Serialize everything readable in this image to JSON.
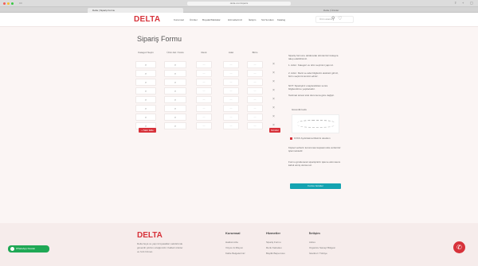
{
  "browser": {
    "url": "delta.com/siparis",
    "tabs": [
      "Delta | Sipariş Formu",
      "Delta | Ürünler"
    ]
  },
  "nav": {
    "logo": "DELTA",
    "menu": [
      "Kurumsal",
      "Ürünler",
      "Boyalar/Markalar",
      "Hizmetlerimiz",
      "İletişim",
      "Sık Sorulan",
      "Katalog"
    ],
    "search_placeholder": "Ürün arama"
  },
  "page_title": "Sipariş Formu",
  "table": {
    "headers": [
      "Kategori Seçin",
      "Ürün Adı / Kodu",
      "Renk",
      "Adet",
      "Birim"
    ],
    "rows": 8,
    "row_placeholder": "—"
  },
  "buttons": {
    "add_row": "+ Satır Ekle",
    "submit_small": "Gönder",
    "submit": "Formu Gönder"
  },
  "info": {
    "p1": "Sipariş formunu doldurarak ürünlerinizi kolayca talep edebilirsiniz.",
    "p2": "1. Adım: Kategori ve ürün seçimini yapınız.",
    "p3": "2. Adım: Renk ve adet bilgilerini eksiksiz giriniz, birim seçimini kontrol ediniz.",
    "p4": "NOT: Siparişiniz onaylandıktan sonra bilgilendirme yapılacaktır.",
    "p5": "Teslimat süresi stok durumuna göre değişir.",
    "captcha_label": "Güvenlik kodu",
    "kvkk": "KVKK Aydınlatma Metnini okudum",
    "p6": "Kişisel verilerin korunması kapsamında verileriniz işlenmektedir.",
    "p7": "Formu göndererek siparişinizin işleme alınmasını kabul etmiş olursunuz."
  },
  "footer": {
    "logo": "DELTA",
    "about": [
      "Delta boya ve yapı kimyasalları sektöründe",
      "güvenilir çözüm ortağınızdır. Kaliteli ürünler",
      "ve hızlı hizmet."
    ],
    "col1_head": "Kurumsal",
    "col1": [
      "Hakkımızda",
      "Vizyon & Misyon",
      "Kalite Belgelerimiz"
    ],
    "col2_head": "Hizmetler",
    "col2": [
      "Sipariş Formu",
      "Renk Kartelası",
      "Bayilik Başvurusu"
    ],
    "col3_head": "İletişim",
    "col3": [
      "Adres",
      "Organize Sanayi Bölgesi",
      "İstanbul / Türkiye"
    ]
  },
  "whatsapp": "WhatsApp Destek",
  "colors": {
    "brand": "#d7323a",
    "teal": "#14a3b1",
    "whatsapp": "#1fa855"
  }
}
